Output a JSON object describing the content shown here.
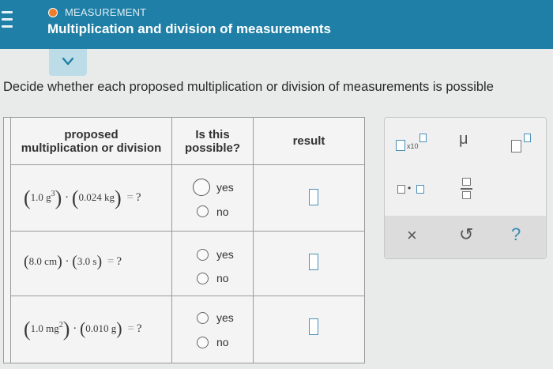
{
  "header": {
    "topic": "MEASUREMENT",
    "title": "Multiplication and division of measurements"
  },
  "question": "Decide whether each proposed multiplication or division of measurements is possible",
  "table": {
    "headers": {
      "col1_line1": "proposed",
      "col1_line2": "multiplication or division",
      "col2_line1": "Is this",
      "col2_line2": "possible?",
      "col3": "result"
    },
    "rows": [
      {
        "a_open": "(",
        "a_num": "1.0 g",
        "a_exp": "3",
        "a_close": ")",
        "op": "·",
        "b_open": "(",
        "b_num": "0.024 kg",
        "b_exp": "",
        "b_close": ")",
        "equals": "=",
        "unknown": "?",
        "yes": "yes",
        "no": "no"
      },
      {
        "a_open": "(",
        "a_num": "8.0 cm",
        "a_exp": "",
        "a_close": ")",
        "op": "·",
        "b_open": "(",
        "b_num": "3.0 s",
        "b_exp": "",
        "b_close": ")",
        "equals": "=",
        "unknown": "?",
        "yes": "yes",
        "no": "no"
      },
      {
        "a_open": "(",
        "a_num": "1.0 mg",
        "a_exp": "2",
        "a_close": ")",
        "op": "·",
        "b_open": "(",
        "b_num": "0.010 g",
        "b_exp": "",
        "b_close": ")",
        "equals": "=",
        "unknown": "?",
        "yes": "yes",
        "no": "no"
      }
    ]
  },
  "palette": {
    "x10": "x10",
    "mu": "μ",
    "times": "×",
    "undo": "↺",
    "help": "?",
    "dot": "•"
  },
  "colors": {
    "header_bg": "#1f7fa6",
    "accent_box": "#4a90b8",
    "topic_dot": "#f07b28"
  }
}
